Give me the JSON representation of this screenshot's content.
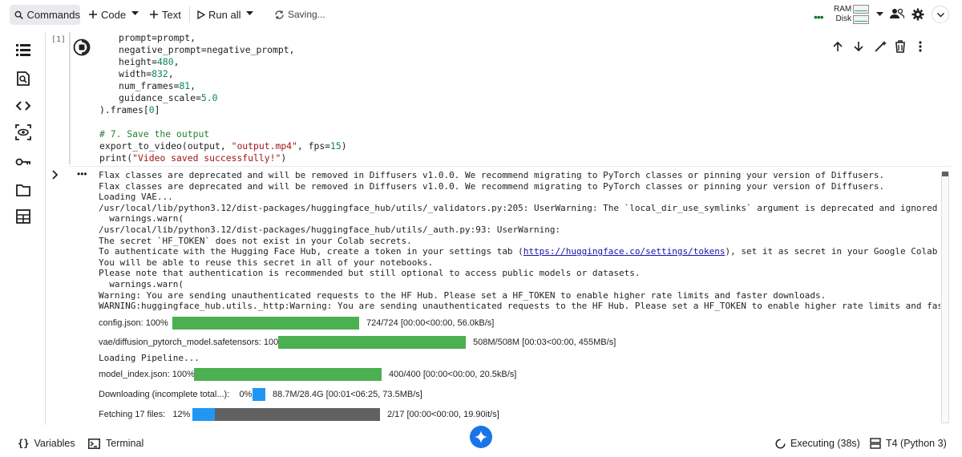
{
  "toolbar": {
    "commands_label": "Commands",
    "code_label": "Code",
    "text_label": "Text",
    "run_all_label": "Run all",
    "saving_label": "Saving...",
    "ram_label": "RAM",
    "disk_label": "Disk"
  },
  "cell": {
    "execution_count": "[1]",
    "code_lines": [
      {
        "cls": "ind",
        "text": "prompt=prompt,"
      },
      {
        "cls": "ind",
        "text": "negative_prompt=negative_prompt,"
      },
      {
        "cls": "ind",
        "text": "height=480,"
      },
      {
        "cls": "ind",
        "text": "width=832,"
      },
      {
        "cls": "ind",
        "text": "num_frames=81,"
      },
      {
        "cls": "ind",
        "text": "guidance_scale=5.0"
      },
      {
        "cls": "",
        "text": ").frames[0]"
      },
      {
        "cls": "",
        "text": ""
      },
      {
        "cls": "comment",
        "text": "# 7. Save the output"
      },
      {
        "cls": "",
        "text": "export_to_video(output, \"output.mp4\", fps=15)"
      },
      {
        "cls": "",
        "text": "print(\"Video saved successfully!\")"
      }
    ]
  },
  "output": {
    "lines": [
      "Flax classes are deprecated and will be removed in Diffusers v1.0.0. We recommend migrating to PyTorch classes or pinning your version of Diffusers.",
      "Flax classes are deprecated and will be removed in Diffusers v1.0.0. We recommend migrating to PyTorch classes or pinning your version of Diffusers.",
      "Loading VAE...",
      "/usr/local/lib/python3.12/dist-packages/huggingface_hub/utils/_validators.py:205: UserWarning: The `local_dir_use_symlinks` argument is deprecated and ignored in `hf_hub_down",
      "  warnings.warn(",
      "/usr/local/lib/python3.12/dist-packages/huggingface_hub/utils/_auth.py:93: UserWarning:",
      "The secret `HF_TOKEN` does not exist in your Colab secrets.",
      "To authenticate with the Hugging Face Hub, create a token in your settings tab (",
      "You will be able to reuse this secret in all of your notebooks.",
      "Please note that authentication is recommended but still optional to access public models or datasets.",
      "  warnings.warn(",
      "Warning: You are sending unauthenticated requests to the HF Hub. Please set a HF_TOKEN to enable higher rate limits and faster downloads.",
      "WARNING:huggingface_hub.utils._http:Warning: You are sending unauthenticated requests to the HF Hub. Please set a HF_TOKEN to enable higher rate limits and faster downloads."
    ],
    "link_text": "https://huggingface.co/settings/tokens",
    "auth_line_suffix": "), set it as secret in your Google Colab and restart you",
    "loading_pipeline": "Loading Pipeline...",
    "progress": [
      {
        "label": "config.json: 100%",
        "fraction": 1.0,
        "color": "#4caf50",
        "stats": "724/724 [00:00<00:00, 56.0kB/s]"
      },
      {
        "label": "vae/diffusion_pytorch_model.safetensors: 100%",
        "fraction": 1.0,
        "color": "#4caf50",
        "stats": "508M/508M [00:03<00:00, 455MB/s]"
      },
      {
        "label": "model_index.json: 100%",
        "fraction": 1.0,
        "color": "#4caf50",
        "stats": "400/400 [00:00<00:00, 20.5kB/s]"
      },
      {
        "label": "Downloading (incomplete total...):    0%",
        "fraction": 0.0,
        "color": "#2196f3",
        "stats": "88.7M/28.4G [00:01<06:25, 73.5MB/s]"
      },
      {
        "label": "Fetching 17 files:   12%",
        "fraction": 0.12,
        "color": "#2196f3",
        "stats": "2/17 [00:00<00:00, 19.90it/s]"
      }
    ]
  },
  "bottombar": {
    "variables_label": "Variables",
    "terminal_label": "Terminal",
    "executing_label": "Executing (38s)",
    "runtime_label": "T4 (Python 3)"
  },
  "icons": {
    "left_rail": [
      "table-of-contents-icon",
      "find-icon",
      "code-snippets-icon",
      "inspect-icon",
      "secrets-key-icon",
      "files-icon",
      "data-table-icon"
    ],
    "accent": "#1a73e8"
  }
}
